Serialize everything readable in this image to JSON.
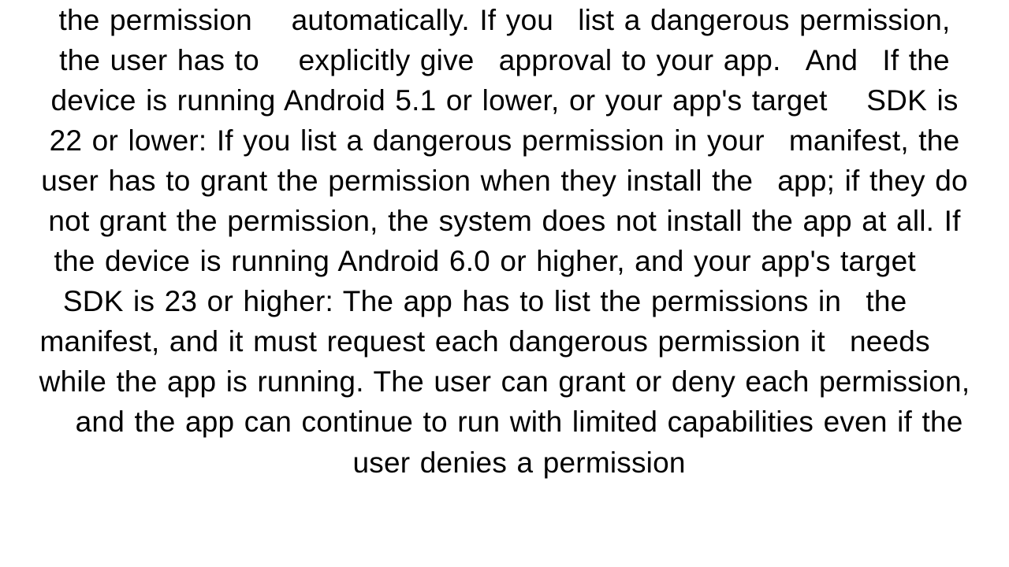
{
  "document": {
    "body_text": "the permission  automatically. If you  list a dangerous permission, the user has to  explicitly give  approval to your app.  And  If the device is running Android 5.1 or lower, or your app's target  SDK is 22 or lower: If you list a dangerous permission in your  manifest, the user has to grant the permission when they install the  app; if they do not grant the permission, the system does not install the app at all. If the device is running Android 6.0 or higher, and your app's target  SDK is 23 or higher: The app has to list the permissions in  the  manifest, and it must request each dangerous permission it  needs  while the app is running. The user can grant or deny each permission,  and the app can continue to run with limited capabilities even if the  user denies a permission"
  }
}
